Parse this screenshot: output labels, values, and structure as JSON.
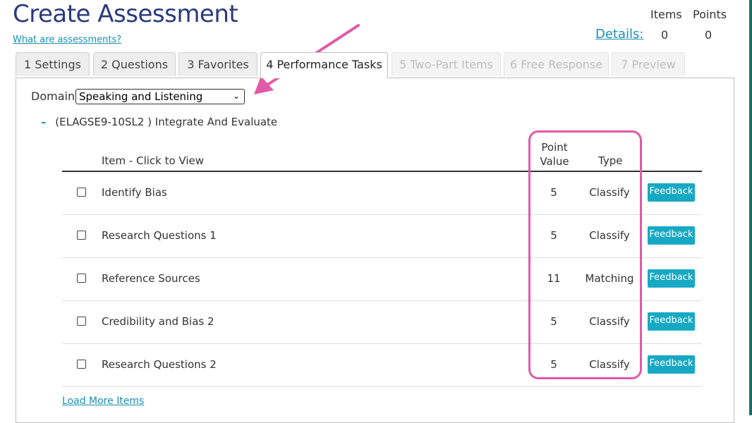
{
  "header": {
    "title": "Create Assessment",
    "what_link": "What are assessments?",
    "details_link": "Details:",
    "items_label": "Items",
    "points_label": "Points",
    "items_value": "0",
    "points_value": "0"
  },
  "tabs": [
    {
      "label": "1 Settings",
      "state": "normal"
    },
    {
      "label": "2 Questions",
      "state": "normal"
    },
    {
      "label": "3 Favorites",
      "state": "normal"
    },
    {
      "label": "4 Performance Tasks",
      "state": "active"
    },
    {
      "label": "5 Two-Part Items",
      "state": "disabled"
    },
    {
      "label": "6 Free Response",
      "state": "disabled"
    },
    {
      "label": "7 Preview",
      "state": "disabled"
    }
  ],
  "domain": {
    "label": "Domain:",
    "selected": "Speaking and Listening"
  },
  "standard": {
    "toggle": "–",
    "label": "(ELAGSE9-10SL2 ) Integrate And Evaluate"
  },
  "columns": {
    "item": "Item - Click to View",
    "point_value": "Point Value",
    "type": "Type"
  },
  "rows": [
    {
      "name": "Identify Bias",
      "points": "5",
      "type": "Classify",
      "feedback": "Feedback"
    },
    {
      "name": "Research Questions 1",
      "points": "5",
      "type": "Classify",
      "feedback": "Feedback"
    },
    {
      "name": "Reference Sources",
      "points": "11",
      "type": "Matching",
      "feedback": "Feedback"
    },
    {
      "name": "Credibility and Bias 2",
      "points": "5",
      "type": "Classify",
      "feedback": "Feedback"
    },
    {
      "name": "Research Questions 2",
      "points": "5",
      "type": "Classify",
      "feedback": "Feedback"
    }
  ],
  "load_more": "Load More Items",
  "colors": {
    "title": "#2a3a7c",
    "link": "#1a8fb3",
    "feedback_button": "#17a9c4",
    "annotation": "#e05aa9",
    "side_bar": "#1b6e63"
  }
}
